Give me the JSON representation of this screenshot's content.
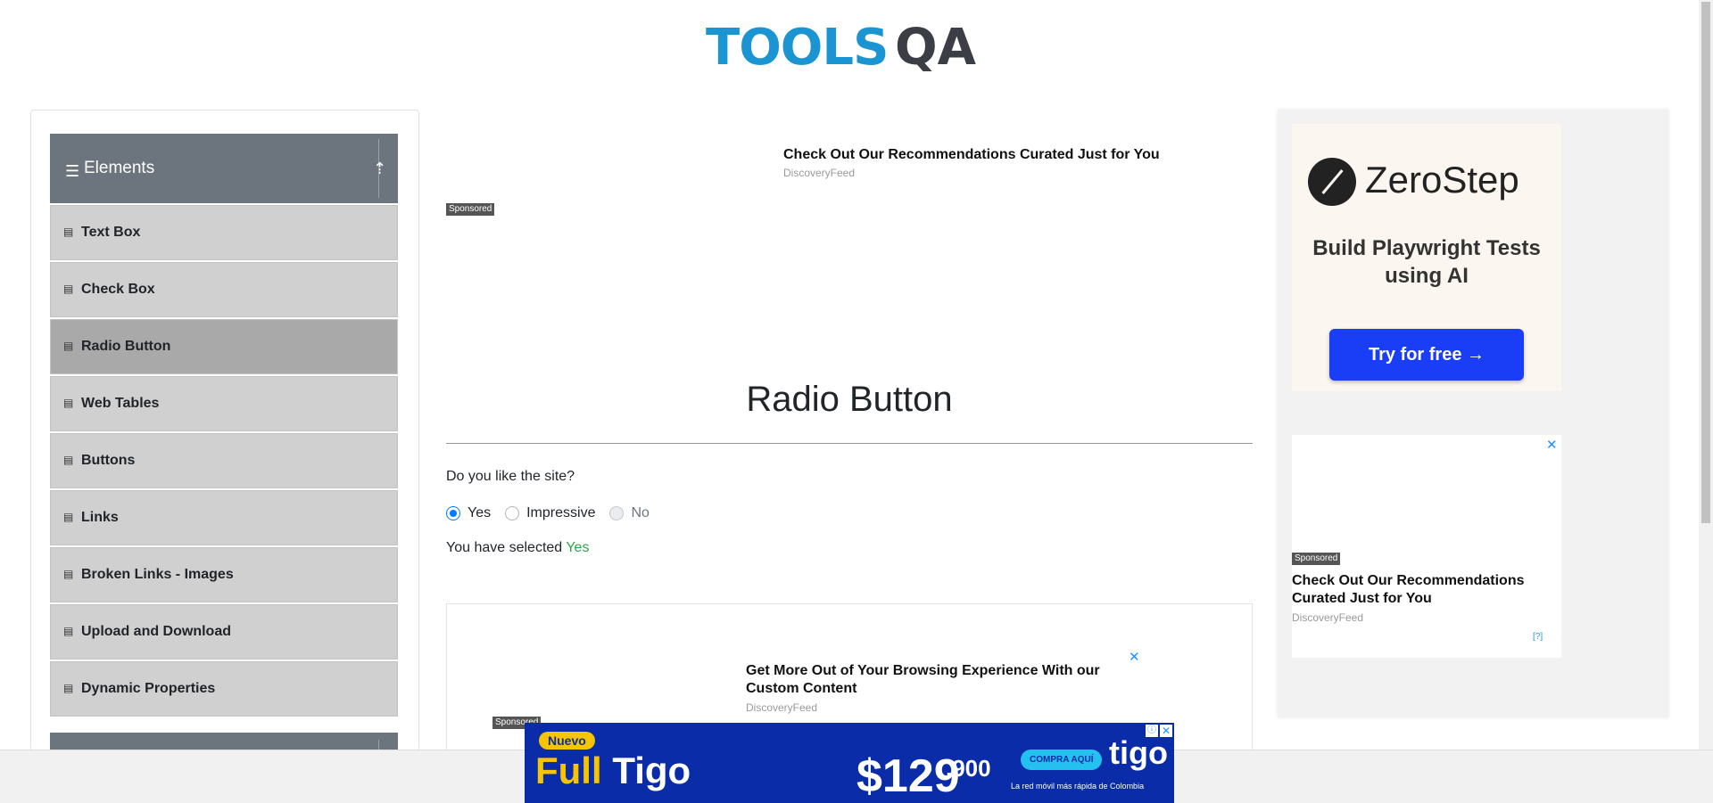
{
  "header": {
    "logo_tools": "TOOLS",
    "logo_qa": "QA"
  },
  "sidebar": {
    "group_title": "Elements",
    "items": [
      {
        "label": "Text Box"
      },
      {
        "label": "Check Box"
      },
      {
        "label": "Radio Button",
        "active": true
      },
      {
        "label": "Web Tables"
      },
      {
        "label": "Buttons"
      },
      {
        "label": "Links"
      },
      {
        "label": "Broken Links - Images"
      },
      {
        "label": "Upload and Download"
      },
      {
        "label": "Dynamic Properties"
      }
    ]
  },
  "main": {
    "top_ad": {
      "title": "Check Out Our Recommendations Curated Just for You",
      "source": "DiscoveryFeed",
      "sponsored": "Sponsored"
    },
    "page_title": "Radio Button",
    "question": "Do you like the site?",
    "options": [
      {
        "label": "Yes",
        "checked": true,
        "disabled": false
      },
      {
        "label": "Impressive",
        "checked": false,
        "disabled": false
      },
      {
        "label": "No",
        "checked": false,
        "disabled": true
      }
    ],
    "result_prefix": "You have selected",
    "result_value": "Yes",
    "bottom_ad": {
      "title": "Get More Out of Your Browsing Experience With our Custom Content",
      "source": "DiscoveryFeed",
      "sponsored": "Sponsored"
    }
  },
  "right_ad": {
    "brand": "ZeroStep",
    "tagline": "Build Playwright Tests using AI",
    "cta": "Try for free →",
    "ad2": {
      "sponsored": "Sponsored",
      "title": "Check Out Our Recommendations Curated Just for You",
      "source": "DiscoveryFeed",
      "choices": "[?]"
    }
  },
  "banner_ad": {
    "badge": "Nuevo",
    "title_a": "Full ",
    "title_b": "Tigo",
    "price": "$129",
    "price_small": ".900",
    "cta": "COMPRA AQUÍ",
    "brand": "tigo",
    "tagline": "La red móvil más rápida de Colombia"
  },
  "colors": {
    "accent": "#007bff",
    "selected_text": "#28a745",
    "sidebar_header": "#6c757d",
    "menu_item": "#d0d0d0",
    "menu_active": "#a9a9a9"
  }
}
